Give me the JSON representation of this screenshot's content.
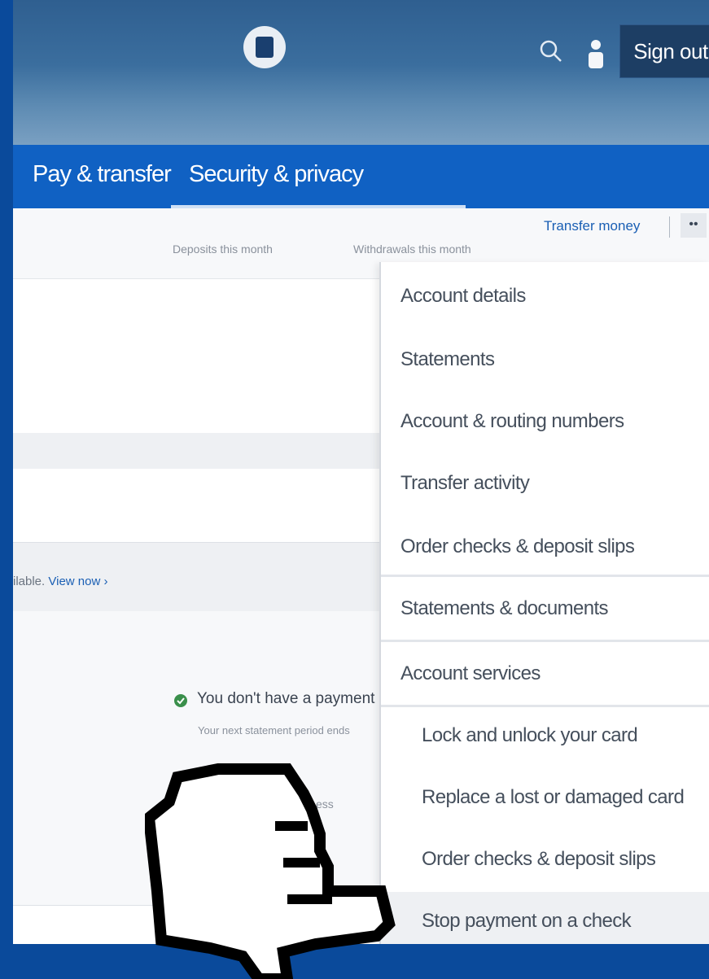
{
  "header": {
    "sign_out_label": "Sign out"
  },
  "nav": {
    "items": [
      {
        "label": "Pay & transfer"
      },
      {
        "label": "Security & privacy"
      }
    ]
  },
  "account_bar": {
    "transfer_link": "Transfer money",
    "more_label": "••",
    "deposits_label": "Deposits this month",
    "withdrawals_label": "Withdrawals this month"
  },
  "content": {
    "available_text": "ilable.",
    "view_now_link": "View now ›",
    "payment_message": "You don't have a payment",
    "payment_sub": "Your next statement period ends",
    "ghost_text": "ess"
  },
  "menu": {
    "items": [
      {
        "label": "Account details"
      },
      {
        "label": "Statements"
      },
      {
        "label": "Account & routing numbers"
      },
      {
        "label": "Transfer activity"
      },
      {
        "label": "Order checks & deposit slips"
      },
      {
        "label": "Statements & documents"
      },
      {
        "label": "Account services"
      }
    ],
    "sub_items": [
      {
        "label": "Lock and unlock your card"
      },
      {
        "label": "Replace a lost or damaged card"
      },
      {
        "label": "Order checks & deposit slips"
      },
      {
        "label": "Stop payment on a check"
      }
    ]
  },
  "colors": {
    "nav_blue": "#1061c3",
    "link_blue": "#1a5fb4",
    "header_dark": "#1d3e64"
  },
  "icons": [
    "chase-logo-icon",
    "search-icon",
    "user-icon",
    "checkmark-circle-icon",
    "hand-pointer-cursor-icon"
  ]
}
